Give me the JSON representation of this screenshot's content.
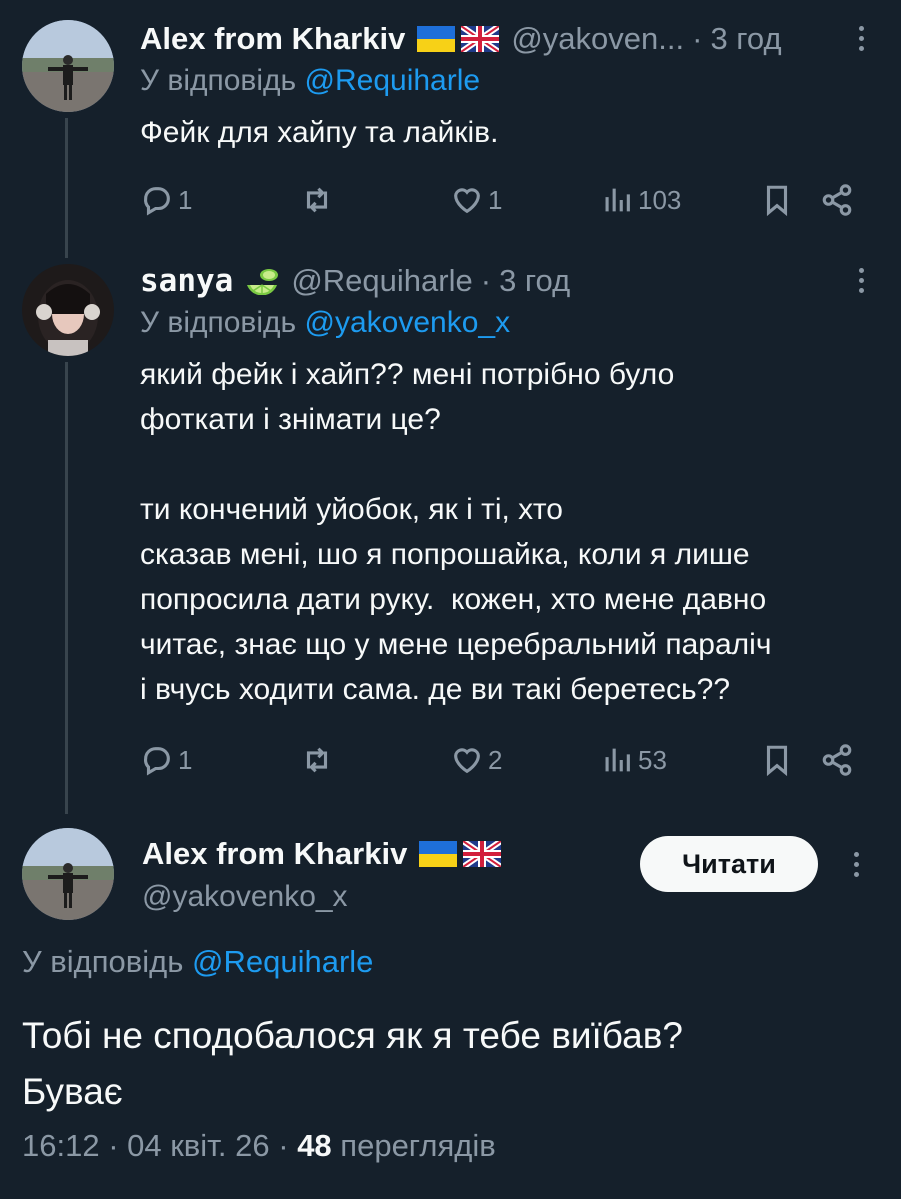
{
  "tweets": [
    {
      "name": "Alex from Kharkiv",
      "handle": "@yakoven...",
      "time": "3 год",
      "reply_prefix": "У відповідь ",
      "reply_to": "@Requiharle",
      "text": "Фейк для хайпу та лайків.",
      "replies": "1",
      "retweets": "",
      "likes": "1",
      "views": "103"
    },
    {
      "name": "sanya",
      "handle": "@Requiharle",
      "time": "3 год",
      "reply_prefix": "У відповідь ",
      "reply_to": "@yakovenko_x",
      "text": "який фейк і хайп?? мені потрібно було\nфоткати і знімати це?\n\nти кончений уйобок, як і ті, хто\nсказав мені, шо я попрошайка, коли я лише\nпопросила дати руку.  кожен, хто мене давно\nчитає, знає що у мене церебральний параліч\nі вчусь ходити сама. де ви такі беретесь??",
      "replies": "1",
      "retweets": "",
      "likes": "2",
      "views": "53"
    }
  ],
  "main": {
    "name": "Alex from Kharkiv",
    "handle": "@yakovenko_x",
    "follow_label": "Читати",
    "reply_prefix": "У відповідь ",
    "reply_to": "@Requiharle",
    "text": "Тобі не сподобалося як я тебе виїбав?\nБуває",
    "time": "16:12",
    "date": "04 квіт. 26",
    "views_count": "48",
    "views_label": "переглядів"
  },
  "colors": {
    "background": "#15202b",
    "link": "#1d9bf0",
    "muted": "#8b98a5",
    "text": "#f7f9f9"
  },
  "icons": [
    "reply-icon",
    "retweet-icon",
    "like-icon",
    "views-icon",
    "bookmark-icon",
    "share-icon",
    "more-icon",
    "ukraine-flag-icon",
    "uk-flag-icon",
    "lime-emoji-icon"
  ]
}
